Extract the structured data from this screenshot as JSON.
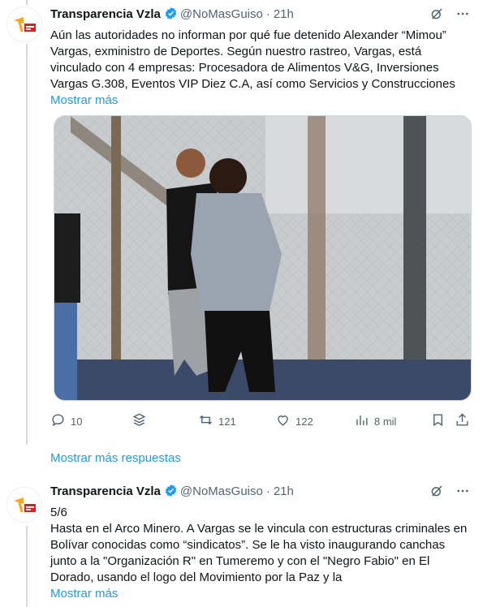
{
  "tweets": [
    {
      "author": "Transparencia Vzla",
      "handle": "@NoMasGuiso",
      "dot": "·",
      "time": "21h",
      "text": "Aún las autoridades no informan por qué fue detenido Alexander “Mimou” Vargas, exministro de Deportes. Según nuestro rastreo, Vargas, está vinculado con 4 empresas: Procesadora de Alimentos V&G, Inversiones Vargas G.308, Eventos VIP Diez C.A, así como Servicios y Construcciones",
      "show_more": "Mostrar más",
      "actions": {
        "replies": "10",
        "reposts": "121",
        "likes": "122",
        "views": "8 mil"
      }
    },
    {
      "author": "Transparencia Vzla",
      "handle": "@NoMasGuiso",
      "dot": "·",
      "time": "21h",
      "text": "5/6\nHasta en el Arco Minero. A Vargas se le vincula con estructuras criminales en Bolívar conocidas como “sindicatos”. Se le ha visto inaugurando canchas junto a la \"Organización R\" en Tumeremo y con el \"Negro Fabio\" en El Dorado, usando el logo del Movimiento por la Paz y la",
      "show_more": "Mostrar más"
    }
  ],
  "show_more_replies": "Mostrar más respuestas",
  "colors": {
    "accent": "#1d9bf0",
    "secondary_text": "#536471",
    "verified": "#1d9bf0",
    "avatar_brand": "#f5a623"
  },
  "icons": [
    "grok-icon",
    "more-icon",
    "reply-icon",
    "stack-icon",
    "repost-icon",
    "like-icon",
    "views-icon",
    "bookmark-icon",
    "share-icon",
    "verified-badge-icon"
  ]
}
